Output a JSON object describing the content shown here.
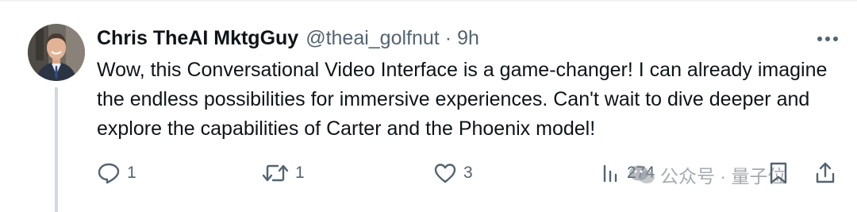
{
  "tweet": {
    "display_name": "Chris TheAI MktgGuy",
    "handle": "@theai_golfnut",
    "separator": "·",
    "time": "9h",
    "text": "Wow, this Conversational Video Interface is a game-changer! I can already imagine the endless possibilities for immersive experiences. Can't wait to dive deeper and explore the capabilities of Carter and the Phoenix model!"
  },
  "actions": {
    "reply_count": "1",
    "retweet_count": "1",
    "like_count": "3",
    "views_count": "274"
  },
  "watermark": {
    "text": "公众号 · 量子位"
  },
  "icons": {
    "more": "more-horizontal-icon",
    "reply": "reply-icon",
    "retweet": "retweet-icon",
    "like": "heart-icon",
    "views": "views-chart-icon",
    "bookmark": "bookmark-icon",
    "share": "share-icon"
  },
  "colors": {
    "text": "#0f1419",
    "secondary": "#536471",
    "thread_line": "#cfd9de",
    "divider": "#eff3f4"
  }
}
